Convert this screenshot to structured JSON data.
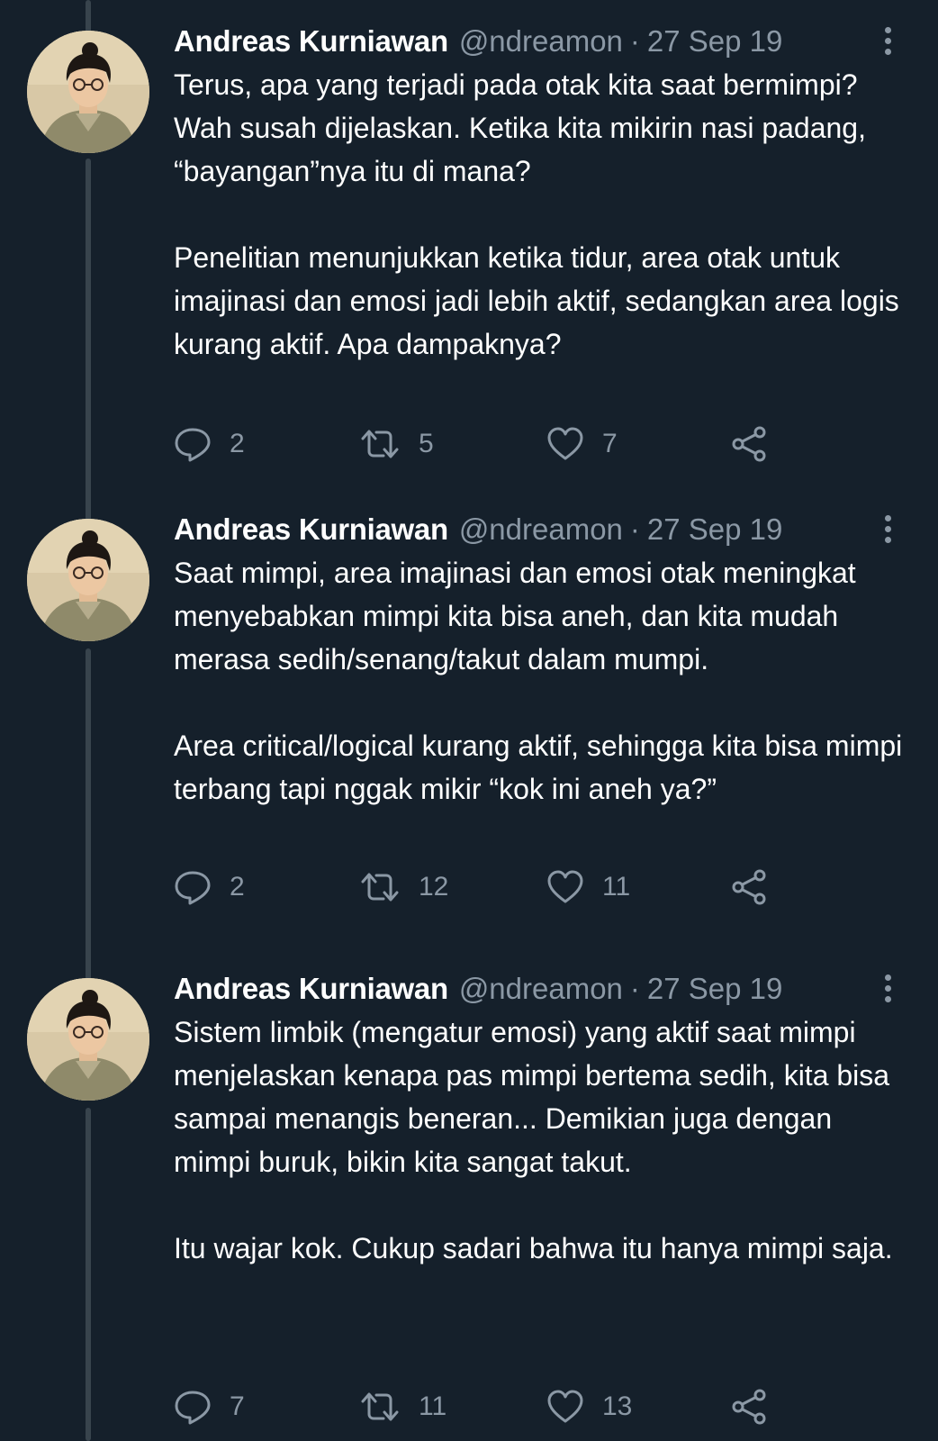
{
  "tweets": [
    {
      "author": "Andreas Kurniawan",
      "handle": "@ndreamon",
      "separator": "·",
      "date": "27 Sep 19",
      "paragraphs": [
        "Terus, apa yang terjadi pada otak kita saat bermimpi? Wah susah dijelaskan. Ketika kita mikirin nasi padang, “bayangan”nya itu di mana?",
        "Penelitian menunjukkan ketika tidur, area otak untuk imajinasi dan emosi jadi lebih aktif, sedangkan area logis kurang aktif. Apa dampaknya?"
      ],
      "replies": "2",
      "retweets": "5",
      "likes": "7"
    },
    {
      "author": "Andreas Kurniawan",
      "handle": "@ndreamon",
      "separator": "·",
      "date": "27 Sep 19",
      "paragraphs": [
        "Saat mimpi, area imajinasi dan emosi otak meningkat menyebabkan mimpi kita bisa aneh, dan kita mudah merasa sedih/senang/takut dalam mumpi.",
        "Area critical/logical kurang aktif, sehingga kita bisa mimpi terbang tapi nggak mikir “kok ini aneh ya?”"
      ],
      "replies": "2",
      "retweets": "12",
      "likes": "11"
    },
    {
      "author": "Andreas Kurniawan",
      "handle": "@ndreamon",
      "separator": "·",
      "date": "27 Sep 19",
      "paragraphs": [
        "Sistem limbik (mengatur emosi) yang aktif saat mimpi menjelaskan kenapa pas mimpi bertema sedih, kita bisa sampai menangis beneran... Demikian juga dengan mimpi buruk, bikin kita sangat takut.",
        "Itu wajar kok. Cukup sadari bahwa itu hanya mimpi saja."
      ],
      "replies": "7",
      "retweets": "11",
      "likes": "13"
    }
  ],
  "icons": {
    "reply": "reply-icon",
    "retweet": "retweet-icon",
    "like": "heart-icon",
    "share": "share-icon",
    "more": "more-options-icon"
  },
  "colors": {
    "background": "#15202b",
    "text": "#ffffff",
    "secondary": "#8b98a5",
    "thread_line": "#38444d"
  }
}
